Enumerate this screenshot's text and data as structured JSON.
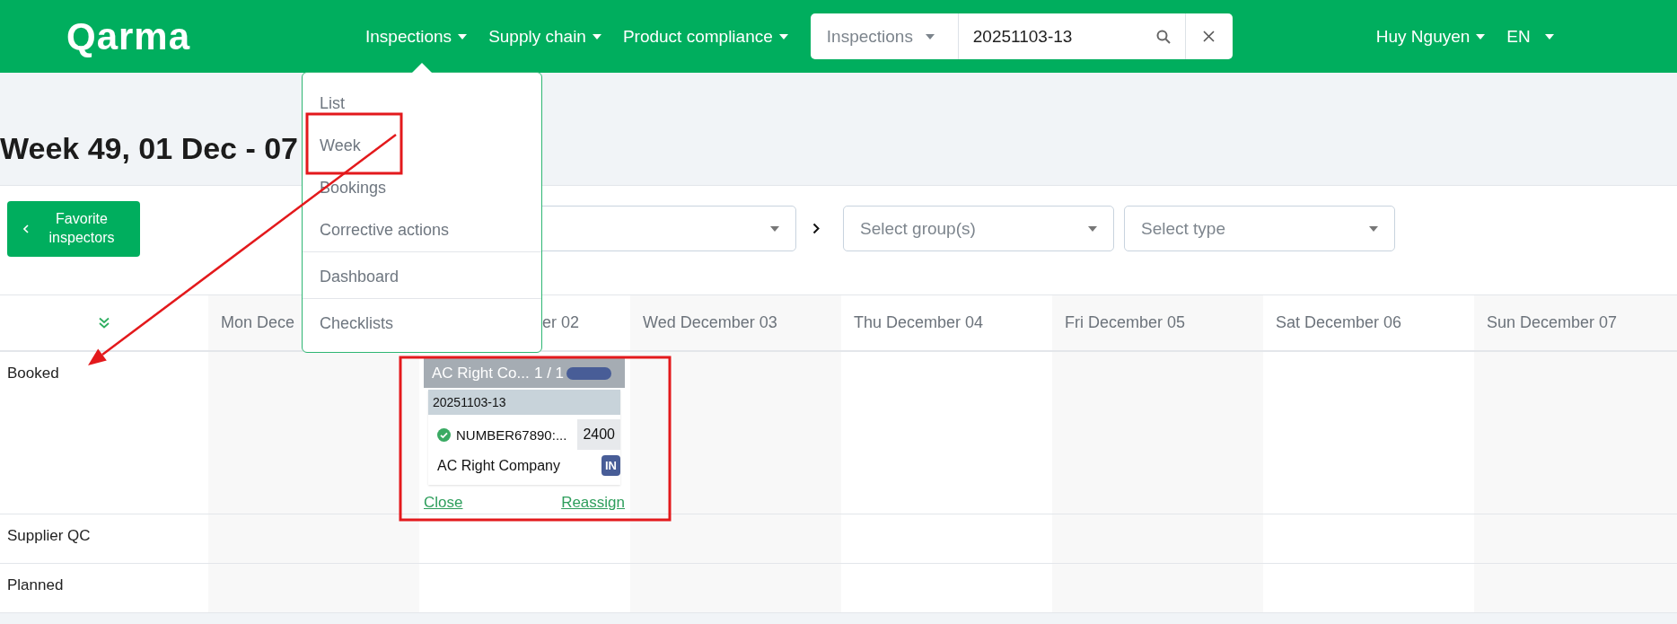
{
  "header": {
    "logo": "Qarma",
    "nav": [
      {
        "label": "Inspections"
      },
      {
        "label": "Supply chain"
      },
      {
        "label": "Product compliance"
      }
    ],
    "search": {
      "scope": "Inspections",
      "value": "20251103-13"
    },
    "user": "Huy Nguyen",
    "language": "EN"
  },
  "nav_menu": {
    "groups": [
      {
        "items": [
          "List",
          "Week",
          "Bookings",
          "Corrective actions"
        ]
      },
      {
        "items": [
          "Dashboard"
        ]
      },
      {
        "items": [
          "Checklists"
        ]
      }
    ]
  },
  "title": "Week 49, 01 Dec - 07",
  "toolbar": {
    "favorite_button": "Favorite inspectors",
    "filters": [
      {
        "placeholder": "Select group(s)"
      },
      {
        "placeholder": "Select type"
      }
    ]
  },
  "calendar": {
    "columns": [
      "Mon Dece",
      "er 02",
      "Wed December 03",
      "Thu December 04",
      "Fri December 05",
      "Sat December 06",
      "Sun December 07"
    ],
    "rows": [
      {
        "label": "Booked",
        "cells": [
          {},
          {
            "card": {
              "title": "AC Right Co...",
              "count": "1 / 1",
              "reference": "20251103-13",
              "items": [
                {
                  "number": "NUMBER67890:...",
                  "quantity": "2400",
                  "done": true
                }
              ],
              "company": "AC Right Company",
              "badge": "IN",
              "actions": [
                "Close",
                "Reassign"
              ]
            }
          },
          {},
          {},
          {},
          {},
          {}
        ]
      },
      {
        "label": "Supplier QC"
      },
      {
        "label": "Planned"
      }
    ]
  },
  "annotations": [
    {
      "kind": "box"
    },
    {
      "kind": "arrow"
    },
    {
      "kind": "box"
    }
  ]
}
